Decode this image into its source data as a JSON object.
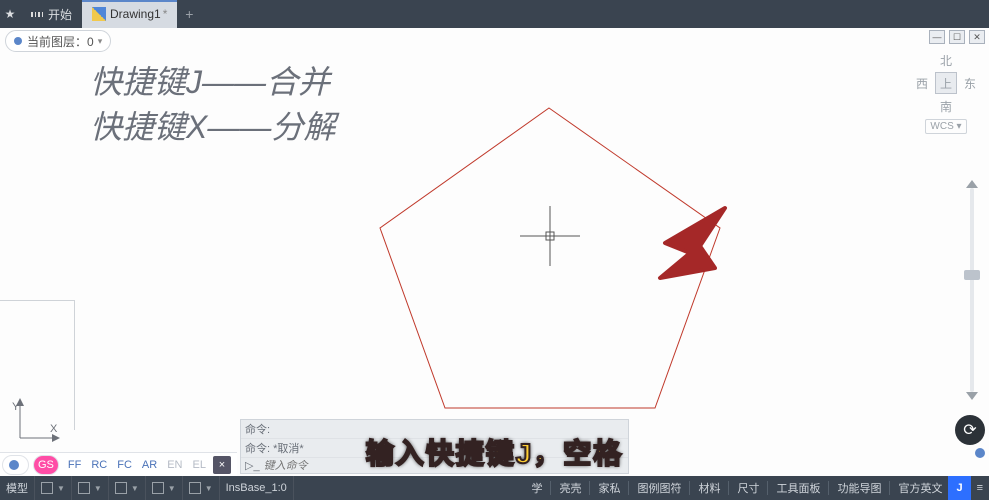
{
  "titlebar": {
    "star": "★",
    "tab_home": "开始",
    "tab_active": "Drawing1",
    "tab_dirty_marker": "*",
    "add": "+"
  },
  "layer_chip": {
    "label": "当前图层：0",
    "chevron": "▾"
  },
  "winctrl": {
    "min": "—",
    "max": "☐",
    "close": "✕"
  },
  "compass": {
    "n": "北",
    "w": "西",
    "top": "上",
    "e": "东",
    "s": "南",
    "wcs": "WCS ▾"
  },
  "handnote": {
    "line1": "快捷键J——合并",
    "line2": "快捷键X——分解"
  },
  "ucs": {
    "y": "Y",
    "x": "X"
  },
  "model_tabs": {
    "gs": "GS",
    "items": [
      "FF",
      "RC",
      "FC",
      "AR",
      "EN",
      "EL"
    ],
    "close": "×"
  },
  "cmdline": {
    "hist1": "命令:",
    "hist2": "命令: *取消*",
    "prompt": "▷_",
    "placeholder": "键入命令"
  },
  "subtitle": "输入快捷键J，空格",
  "statusbar": {
    "model": "模型",
    "coord_hint": "InsBase_1:0",
    "right": [
      "学",
      "亮壳",
      "家私",
      "图例图符",
      "材料",
      "尺寸",
      "工具面板",
      "功能导图",
      "官方英文"
    ],
    "blue": "J",
    "menu": "≡"
  }
}
